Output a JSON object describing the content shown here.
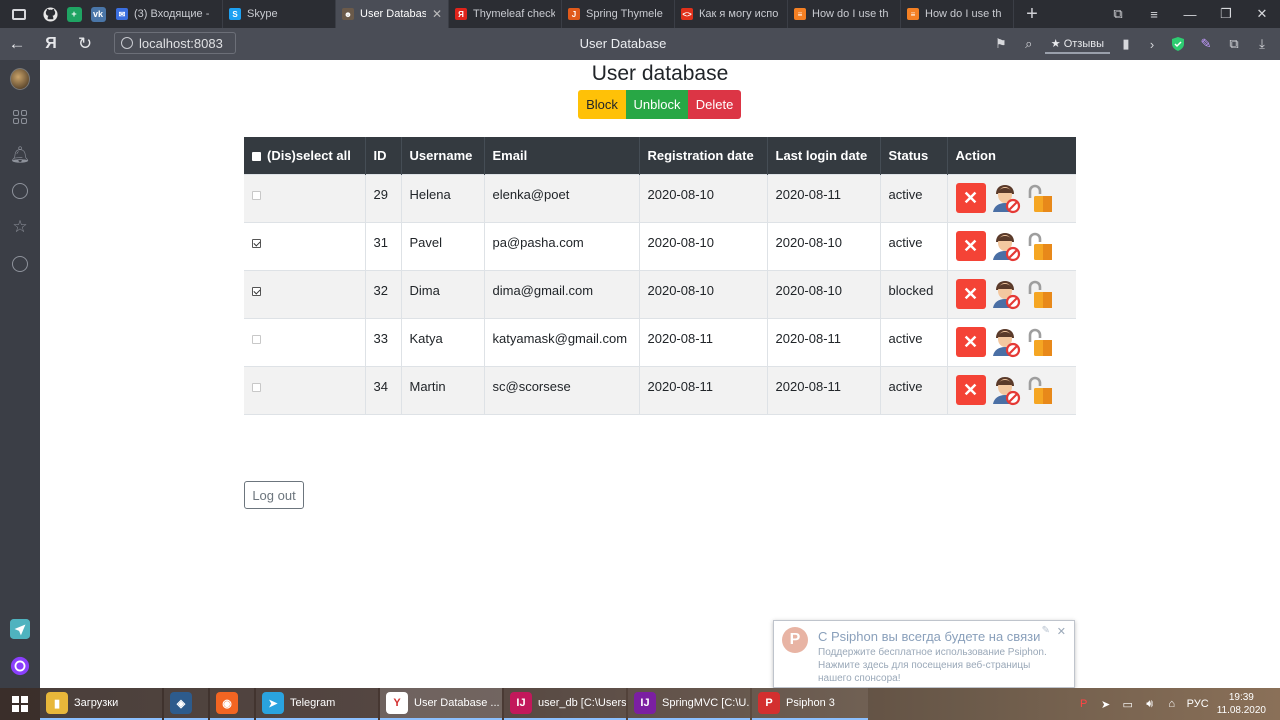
{
  "browser": {
    "tabs": [
      {
        "label": "(3) Входящие -",
        "color": "#3b6fe0",
        "glyph": "✉",
        "active": false
      },
      {
        "label": "Skype",
        "color": "#1da1f2",
        "glyph": "S",
        "active": false
      },
      {
        "label": "User Databas",
        "color": "#6b5a4a",
        "glyph": "☻",
        "active": true
      },
      {
        "label": "Thymeleaf check",
        "color": "#e0241b",
        "glyph": "Я",
        "active": false
      },
      {
        "label": "Spring Thymele",
        "color": "#e05a1b",
        "glyph": "J",
        "active": false
      },
      {
        "label": "Как я могу испо",
        "color": "#e0311b",
        "glyph": "<>",
        "active": false
      },
      {
        "label": "How do I use th",
        "color": "#f48024",
        "glyph": "≡",
        "active": false
      },
      {
        "label": "How do I use th",
        "color": "#f48024",
        "glyph": "≡",
        "active": false
      }
    ],
    "address": "localhost:8083",
    "page_title": "User Database",
    "reviews_label": "★ Отзывы",
    "yandex_glyph": "Я"
  },
  "page": {
    "title": "User database",
    "toolbar": {
      "block": "Block",
      "unblock": "Unblock",
      "delete": "Delete"
    },
    "table": {
      "headers": {
        "select_all": "(Dis)select all",
        "id": "ID",
        "username": "Username",
        "email": "Email",
        "reg_date": "Registration date",
        "login_date": "Last login date",
        "status": "Status",
        "action": "Action"
      },
      "rows": [
        {
          "checked": false,
          "id": "29",
          "username": "Helena",
          "email": "elenka@poet",
          "reg": "2020-08-10",
          "login": "2020-08-11",
          "status": "active"
        },
        {
          "checked": true,
          "id": "31",
          "username": "Pavel",
          "email": "pa@pasha.com",
          "reg": "2020-08-10",
          "login": "2020-08-10",
          "status": "active"
        },
        {
          "checked": true,
          "id": "32",
          "username": "Dima",
          "email": "dima@gmail.com",
          "reg": "2020-08-10",
          "login": "2020-08-10",
          "status": "blocked"
        },
        {
          "checked": false,
          "id": "33",
          "username": "Katya",
          "email": "katyamask@gmail.com",
          "reg": "2020-08-11",
          "login": "2020-08-11",
          "status": "active"
        },
        {
          "checked": false,
          "id": "34",
          "username": "Martin",
          "email": "sc@scorsese",
          "reg": "2020-08-11",
          "login": "2020-08-11",
          "status": "active"
        }
      ]
    },
    "logout": "Log out"
  },
  "notification": {
    "title": "С Psiphon вы всегда будете на связи",
    "body": "Поддержите бесплатное использование Psiphon. Нажмите здесь для посещения веб-страницы нашего спонсора!",
    "logo_glyph": "P"
  },
  "taskbar": {
    "items": [
      {
        "label": "Загрузки",
        "color": "#e8b73a",
        "glyph": "▮",
        "active": false
      },
      {
        "label": "",
        "color": "#2d5b8c",
        "glyph": "◈",
        "active": false
      },
      {
        "label": "",
        "color": "#f26522",
        "glyph": "◉",
        "active": false
      },
      {
        "label": "Telegram",
        "color": "#2aa3df",
        "glyph": "➤",
        "active": false
      },
      {
        "label": "User Database ...",
        "color": "#ffffff",
        "glyph": "Y",
        "active": true
      },
      {
        "label": "user_db [C:\\Users...",
        "color": "#c2185b",
        "glyph": "IJ",
        "active": false
      },
      {
        "label": "SpringMVC [C:\\U...",
        "color": "#7b1fa2",
        "glyph": "IJ",
        "active": false
      },
      {
        "label": "Psiphon 3",
        "color": "#d32f2f",
        "glyph": "P",
        "active": false
      }
    ],
    "lang": "РУС",
    "time": "19:39",
    "date": "11.08.2020"
  },
  "colors": {
    "block": "#ffc107",
    "unblock": "#28a745",
    "delete": "#dc3545",
    "table_header": "#343a40"
  }
}
